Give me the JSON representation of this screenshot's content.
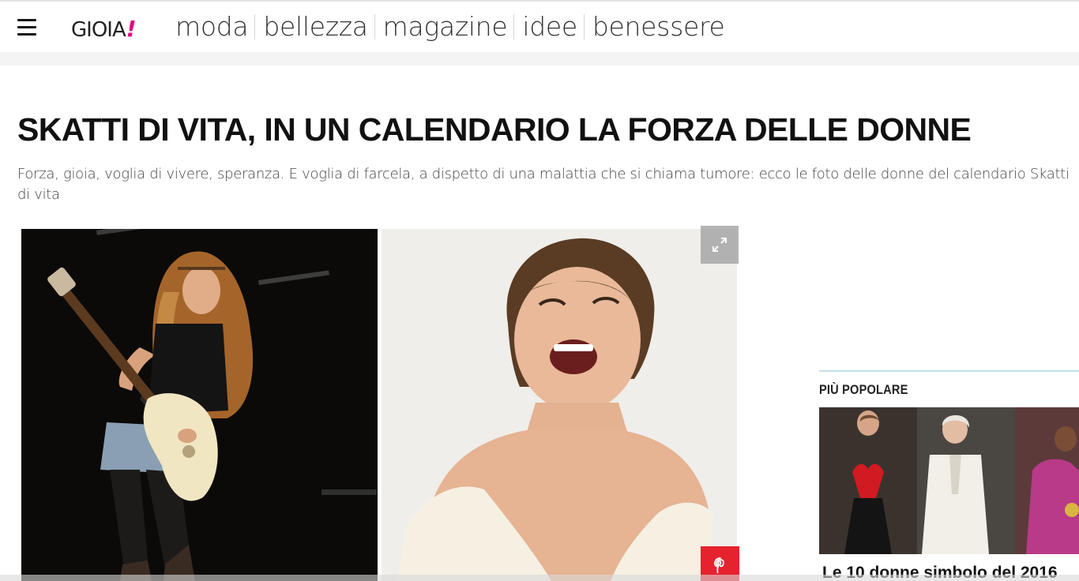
{
  "header": {
    "logo_text": "GIOIA",
    "logo_mark": "!",
    "nav": [
      "moda",
      "bellezza",
      "magazine",
      "idee",
      "benessere"
    ]
  },
  "article": {
    "title": "SKATTI DI VITA, IN UN CALENDARIO LA FORZA DELLE DONNE",
    "subtitle": "Forza, gioia, voglia di vivere, speranza. E voglia di farcela, a dispetto di una malattia che si chiama tumore: ecco le foto delle donne del calendario Skatti di vita"
  },
  "gallery": {
    "expand_icon": "expand-icon",
    "pinterest_icon": "pinterest-icon"
  },
  "sidebar": {
    "heading": "PIÙ POPOLARE",
    "caption": "Le 10 donne simbolo del 2016"
  },
  "colors": {
    "brand_accent": "#e4007c",
    "pinterest": "#e6222e",
    "sidebar_rule": "#bfe3ea"
  }
}
